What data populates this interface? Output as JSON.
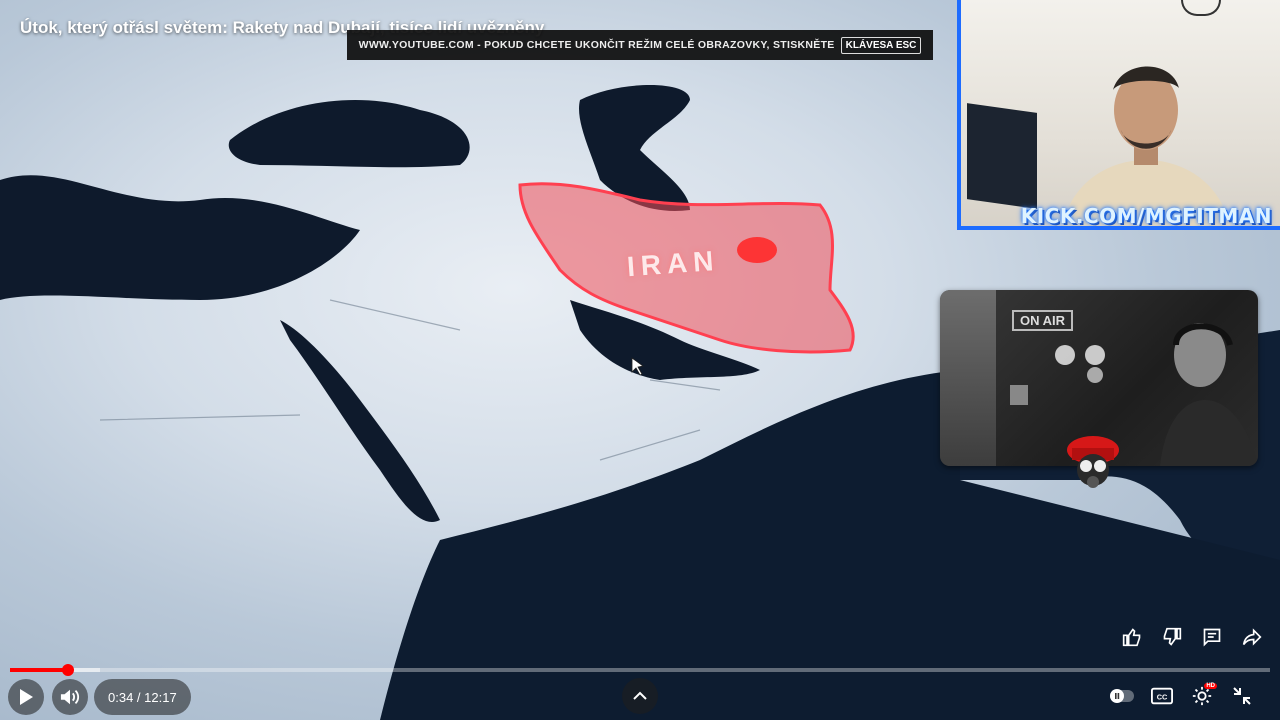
{
  "video": {
    "title": "Útok, který otřásl světem: Rakety nad Dubají, tisíce lidí uvězněny",
    "map_label": "IRAN"
  },
  "fullscreen_banner": {
    "message": "WWW.YOUTUBE.COM - POKUD CHCETE UKONČIT REŽIM CELÉ OBRAZOVKY, STISKNĚTE",
    "key": "KLÁVESA ESC"
  },
  "webcam_top": {
    "overlay_text": "KICK.COM/MGFITMAN"
  },
  "webcam_mid": {
    "sign_text": "ON AIR"
  },
  "actions": {
    "like_icon": "thumbs-up-icon",
    "dislike_icon": "thumbs-down-icon",
    "comments_icon": "comment-icon",
    "share_icon": "share-icon"
  },
  "player": {
    "current_time": "0:34",
    "duration": "12:17",
    "time_display": "0:34 / 12:17",
    "progress_fraction": 0.046,
    "accent_color": "#ff0000",
    "quality_badge": "HD"
  }
}
